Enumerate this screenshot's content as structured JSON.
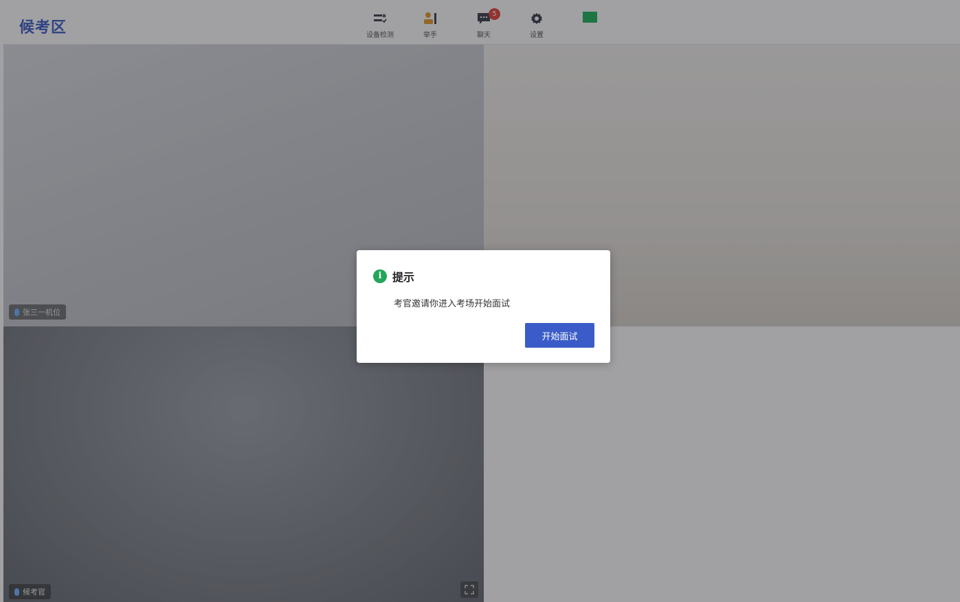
{
  "header": {
    "title": "候考区",
    "tools": [
      {
        "label": "设备检测",
        "icon": "device-check-icon"
      },
      {
        "label": "举手",
        "icon": "raise-hand-icon"
      },
      {
        "label": "聊天",
        "icon": "chat-icon",
        "badge": "5"
      },
      {
        "label": "设置",
        "icon": "gear-icon"
      }
    ],
    "status_color": "#1bb35a"
  },
  "videos": {
    "tile1": {
      "name": "张三一机位"
    },
    "tile3": {
      "name": "候考官"
    }
  },
  "dialog": {
    "title": "提示",
    "message": "考官邀请你进入考场开始面试",
    "button": "开始面试"
  },
  "colors": {
    "brand": "#3b5cc8",
    "info": "#23a55a",
    "badge": "#e5433b",
    "accent_orange": "#e69a2e"
  }
}
